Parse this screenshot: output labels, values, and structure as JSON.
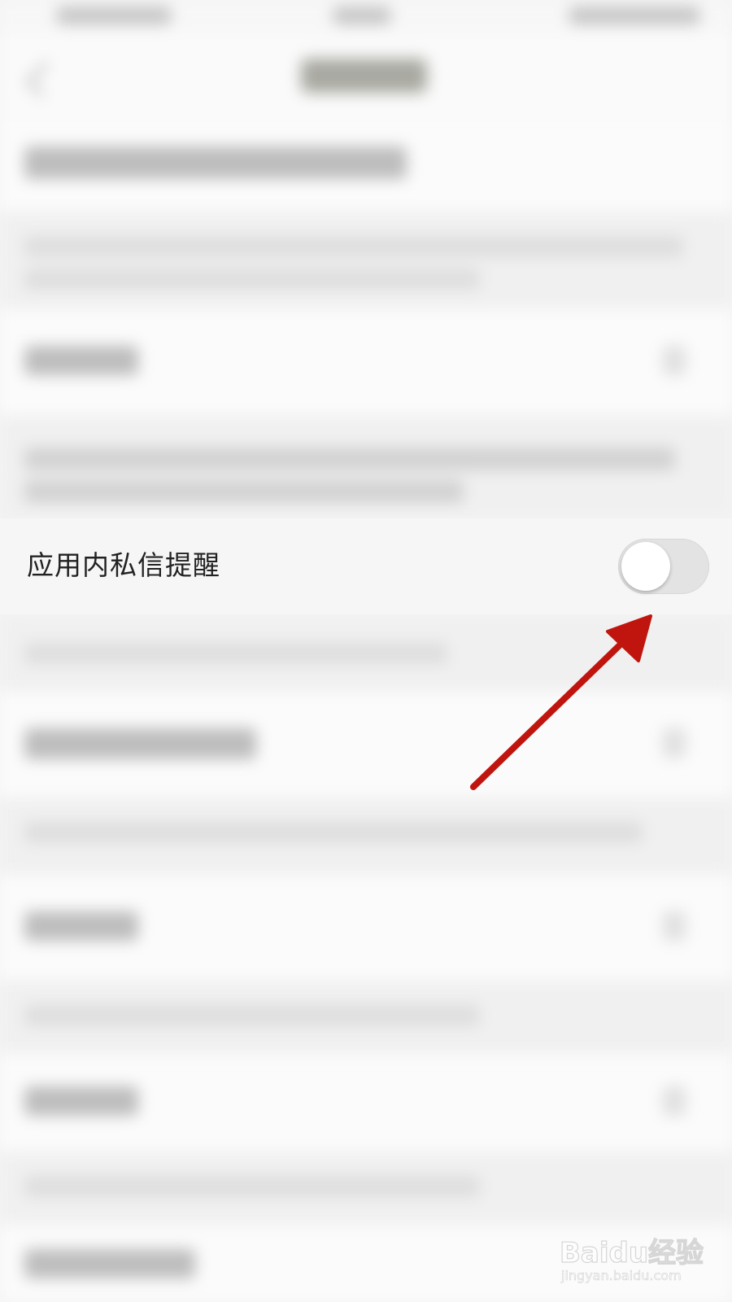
{
  "setting_row": {
    "label": "应用内私信提醒",
    "toggle": {
      "state": "off",
      "track_color": "#e3e3e3",
      "knob_color": "#ffffff"
    }
  },
  "annotation": {
    "type": "arrow",
    "color": "#c0150f",
    "points_to": "toggle"
  },
  "watermark": {
    "logo_text": "Baidu经验",
    "url": "jingyan.baidu.com"
  }
}
